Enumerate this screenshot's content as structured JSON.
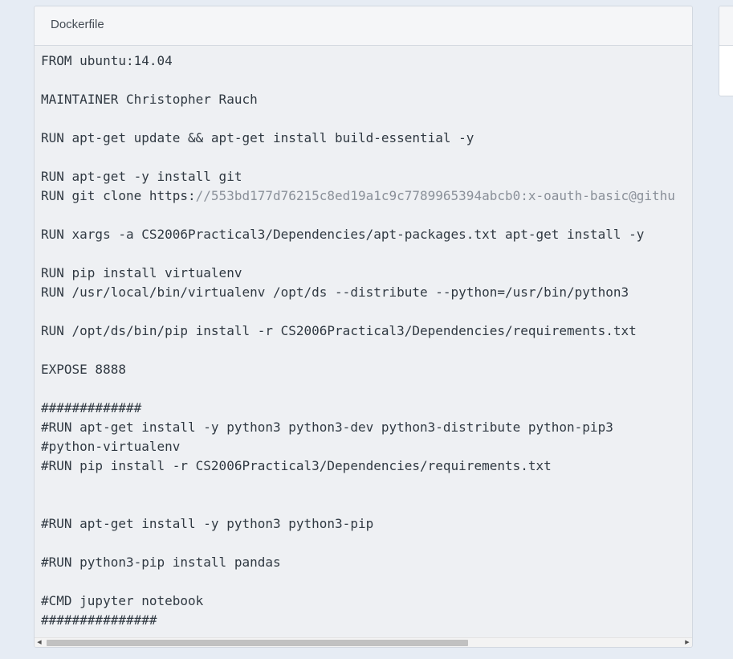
{
  "panel": {
    "title": "Dockerfile"
  },
  "code": {
    "lines": [
      "FROM ubuntu:14.04",
      "",
      "MAINTAINER Christopher Rauch",
      "",
      "RUN apt-get update && apt-get install build-essential -y",
      "",
      "RUN apt-get -y install git",
      "RUN git clone https:",
      "",
      "RUN xargs -a CS2006Practical3/Dependencies/apt-packages.txt apt-get install -y",
      "",
      "RUN pip install virtualenv",
      "RUN /usr/local/bin/virtualenv /opt/ds --distribute --python=/usr/bin/python3",
      "",
      "RUN /opt/ds/bin/pip install -r CS2006Practical3/Dependencies/requirements.txt",
      "",
      "EXPOSE 8888",
      "",
      "#############",
      "#RUN apt-get install -y python3 python3-dev python3-distribute python-pip3",
      "#python-virtualenv",
      "#RUN pip install -r CS2006Practical3/Dependencies/requirements.txt",
      "",
      "",
      "#RUN apt-get install -y python3 python3-pip",
      "",
      "#RUN python3-pip install pandas",
      "",
      "#CMD jupyter notebook",
      "###############"
    ],
    "git_url_tail": "//553bd177d76215c8ed19a1c9c7789965394abcb0:x-oauth-basic@githu"
  },
  "scrollbar": {
    "left_arrow": "◀",
    "right_arrow": "▶"
  },
  "colors": {
    "background": "#e6ecf4",
    "code_text": "#303942",
    "url_text": "#8a9099"
  }
}
